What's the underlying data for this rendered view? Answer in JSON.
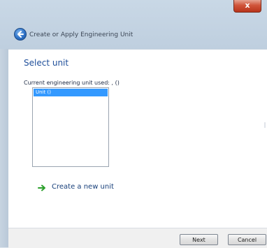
{
  "window": {
    "close_glyph": "x",
    "title": "Create or Apply Engineering Unit"
  },
  "nav": {
    "back_icon": "back-arrow-icon"
  },
  "page": {
    "heading": "Select unit",
    "current_label": "Current engineering unit used: , ()",
    "list_items": [
      "Unit ()"
    ]
  },
  "actions": {
    "create_unit_label": "Create a new unit",
    "create_unit_icon": "green-arrow-icon"
  },
  "buttons": {
    "next_label": "Next",
    "cancel_label": "Cancel"
  },
  "colors": {
    "accent": "#3399ff",
    "heading": "#1e4e9a",
    "link_arrow": "#2ca02c"
  }
}
